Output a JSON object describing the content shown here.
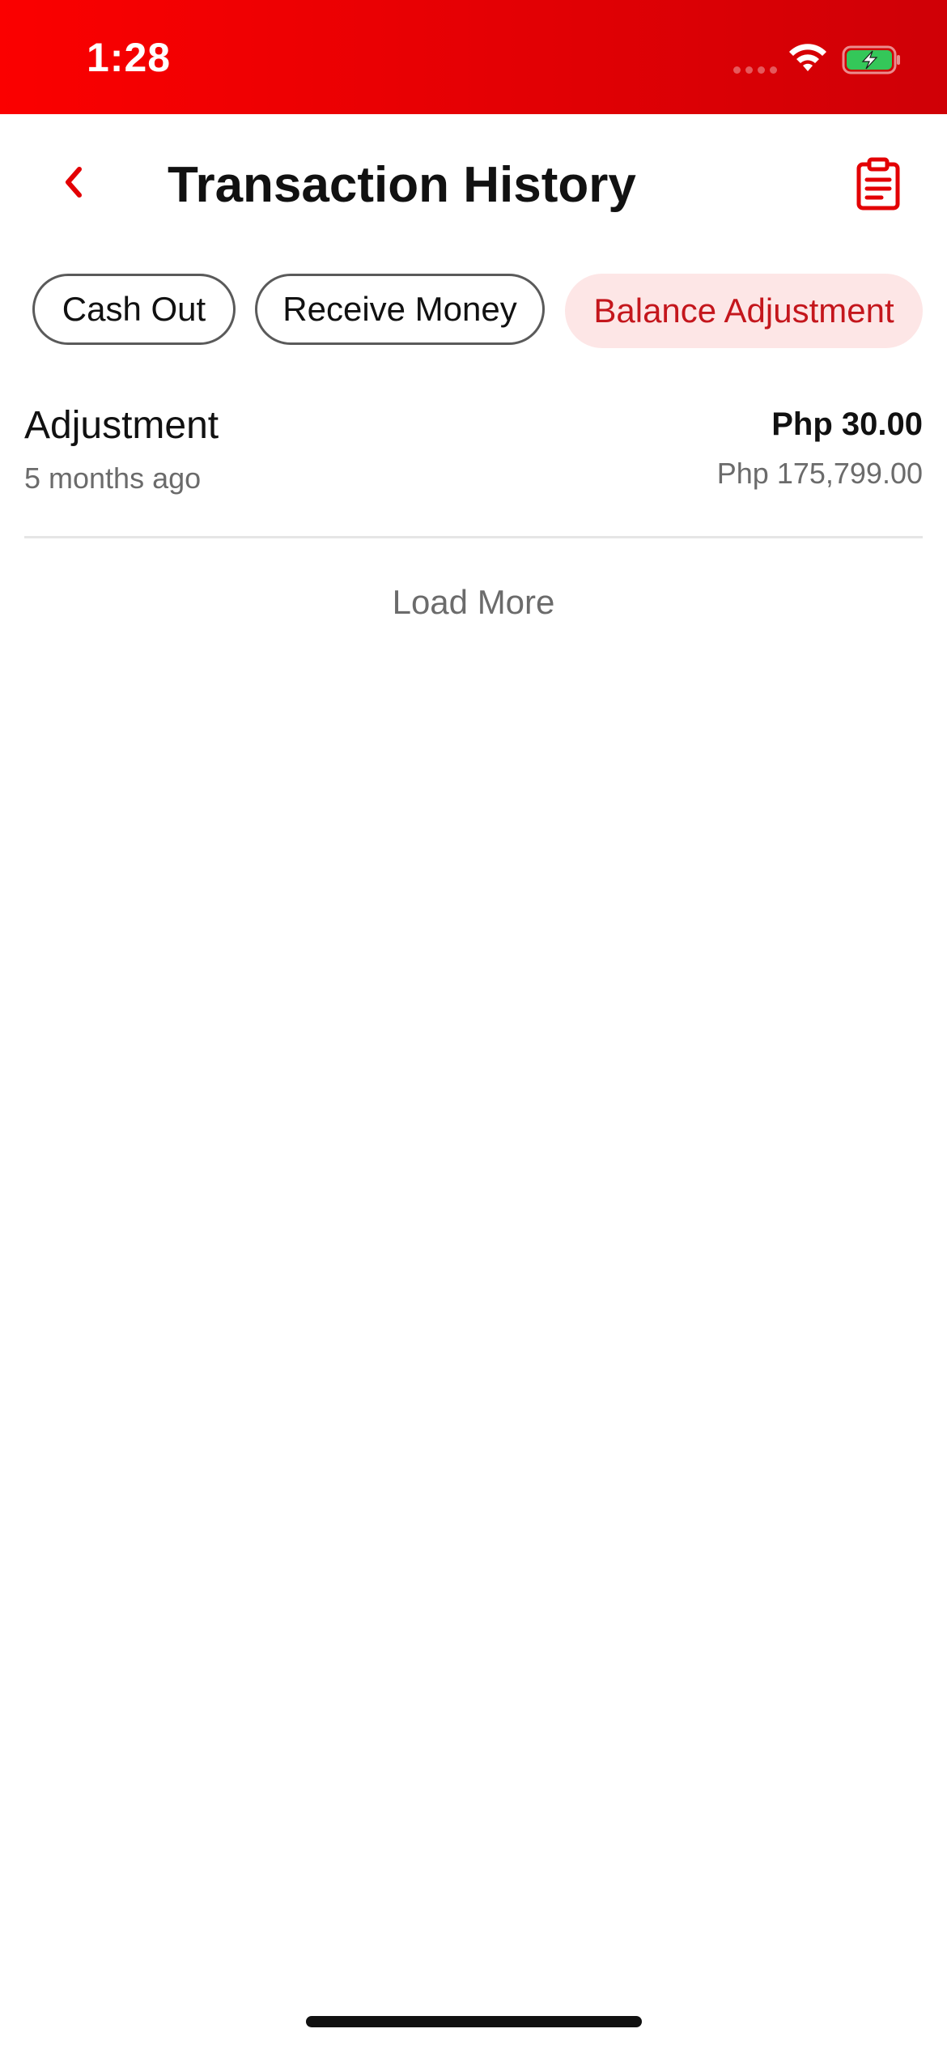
{
  "status_bar": {
    "time": "1:28",
    "icons": [
      "cellular-signal-icon",
      "wifi-icon",
      "battery-charging-icon"
    ]
  },
  "header": {
    "title": "Transaction History",
    "back_icon": "chevron-left-icon",
    "action_icon": "clipboard-icon"
  },
  "filters": [
    {
      "label": "Cash Out",
      "selected": false
    },
    {
      "label": "Receive Money",
      "selected": false
    },
    {
      "label": "Balance Adjustment",
      "selected": true
    }
  ],
  "transactions": [
    {
      "title": "Adjustment",
      "time": "5 months ago",
      "amount": "Php 30.00",
      "balance": "Php 175,799.00"
    }
  ],
  "load_more_label": "Load More",
  "colors": {
    "brand_red": "#e30004",
    "accent_text": "#c4161c",
    "chip_selected_bg": "#fde6e6",
    "battery_green": "#34c759"
  }
}
